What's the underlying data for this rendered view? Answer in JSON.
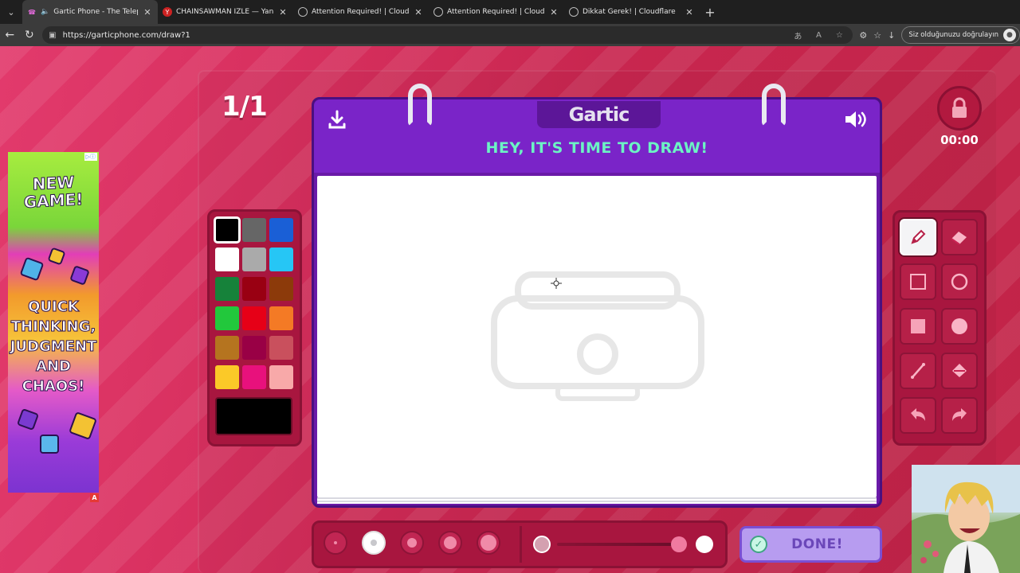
{
  "browser": {
    "tabs": [
      {
        "title": "Gartic Phone - The Telephone",
        "active": true,
        "audio": true
      },
      {
        "title": "CHAİNSAWMAN İZLE — Yandex",
        "active": false
      },
      {
        "title": "Attention Required! | Cloudflare",
        "active": false
      },
      {
        "title": "Attention Required! | Cloudflare",
        "active": false
      },
      {
        "title": "Dikkat Gerek! | Cloudflare",
        "active": false
      }
    ],
    "url": "https://garticphone.com/draw?1",
    "verify_label": "Siz olduğunuzu doğrulayın"
  },
  "game": {
    "round": "1/1",
    "logo": "Gartic",
    "headline": "HEY, IT'S TIME TO DRAW!",
    "timer": "00:00",
    "done_label": "DONE!",
    "palette": [
      "#000000",
      "#666666",
      "#1a5fd6",
      "#ffffff",
      "#aaaaaa",
      "#26c6f5",
      "#16823a",
      "#990012",
      "#8c3a0a",
      "#22c83c",
      "#e60017",
      "#f47a25",
      "#b5741f",
      "#990045",
      "#c9505d",
      "#fbc928",
      "#e8117c",
      "#f8a9a9"
    ],
    "selected_color": "#000000",
    "tools": [
      "pen-icon",
      "eraser-icon",
      "rect-outline-icon",
      "circle-outline-icon",
      "rect-fill-icon",
      "circle-fill-icon",
      "line-icon",
      "fill-bucket-icon",
      "undo-icon",
      "redo-icon"
    ],
    "selected_tool": "pen-icon",
    "brush_sizes": [
      2,
      4,
      6,
      8,
      10
    ],
    "selected_size_index": 1
  },
  "ad": {
    "headline": "NEW GAME!",
    "tagline": "QUICK THINKING, JUDGMENT AND CHAOS!"
  }
}
